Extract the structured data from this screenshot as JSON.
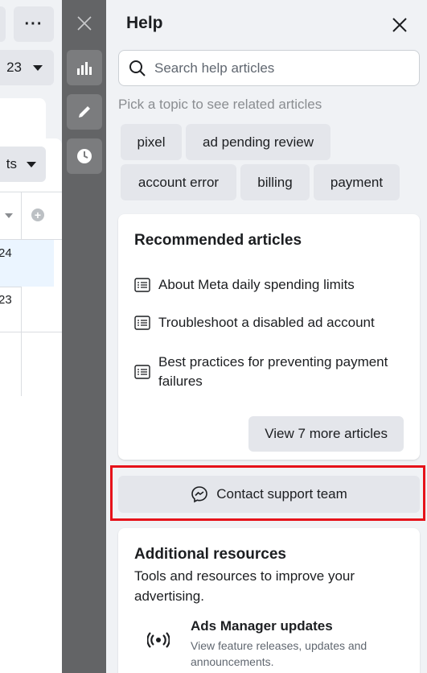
{
  "left": {
    "more_label": "···",
    "date_fragment": "23",
    "columns_fragment": "ts",
    "row1_value": "24",
    "row2_value": "23"
  },
  "rail": {
    "icons": [
      "close-icon",
      "chart-icon",
      "edit-icon",
      "clock-icon"
    ]
  },
  "help": {
    "title": "Help",
    "search_placeholder": "Search help articles",
    "pick_topic_label": "Pick a topic to see related articles",
    "topics": [
      "pixel",
      "ad pending review",
      "account error",
      "billing",
      "payment"
    ],
    "recommended": {
      "title": "Recommended articles",
      "articles": [
        "About Meta daily spending limits",
        "Troubleshoot a disabled ad account",
        "Best practices for preventing payment failures"
      ],
      "view_more_label": "View 7 more articles"
    },
    "contact_label": "Contact support team",
    "resources": {
      "title": "Additional resources",
      "subtitle": "Tools and resources to improve your advertising.",
      "items": [
        {
          "title": "Ads Manager updates",
          "description": "View feature releases, updates and announcements."
        }
      ]
    }
  },
  "colors": {
    "highlight": "#e6121a",
    "rail": "#636466",
    "chip": "#e4e6eb"
  }
}
